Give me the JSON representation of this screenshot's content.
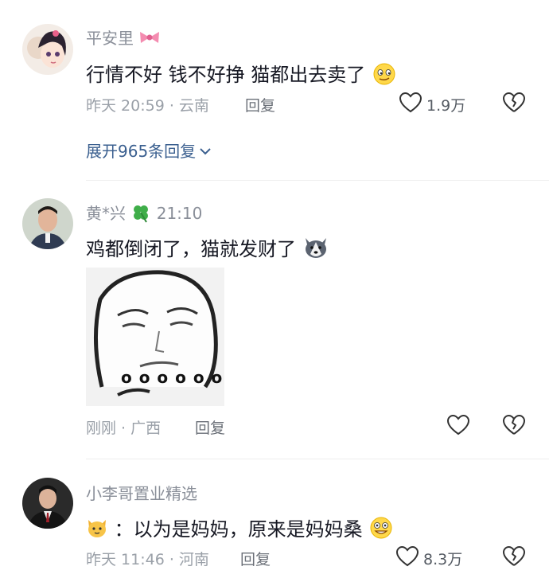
{
  "comments": [
    {
      "username": "平安里",
      "text": "行情不好 钱不好挣 猫都出去卖了",
      "time_location": "昨天 20:59 · 云南",
      "reply_label": "回复",
      "likes": "1.9万",
      "expand_label": "展开965条回复"
    },
    {
      "username": "黄*兴",
      "time_inline": "21:10",
      "text": "鸡都倒闭了，猫就发财了",
      "meme_dots": "o o o o o o",
      "time_location": "刚刚 · 广西",
      "reply_label": "回复"
    },
    {
      "username": "小李哥置业精选",
      "text": "：以为是妈妈，原来是妈妈桑",
      "time_location": "昨天 11:46 · 河南",
      "reply_label": "回复",
      "likes": "8.3万"
    }
  ],
  "colors": {
    "username": "#8a8f99",
    "text": "#161823",
    "meta": "#9aa0a8",
    "expand": "#3a5f8f"
  }
}
